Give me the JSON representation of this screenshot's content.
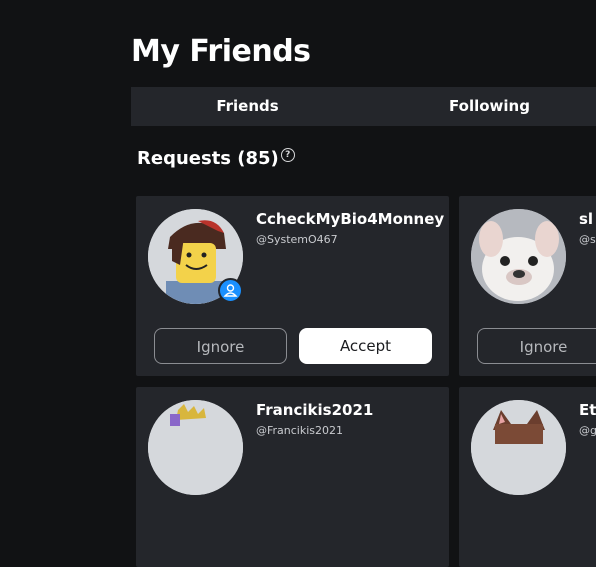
{
  "page": {
    "title": "My Friends"
  },
  "tabs": [
    {
      "label": "Friends"
    },
    {
      "label": "Following"
    }
  ],
  "requests": {
    "title": "Requests (85)",
    "help_glyph": "?",
    "cards": [
      {
        "name": "CcheckMyBio4Monney",
        "handle": "@SystemO467",
        "ignore_label": "Ignore",
        "accept_label": "Accept"
      },
      {
        "name": "sl",
        "handle": "@s",
        "ignore_label": "Ignore"
      },
      {
        "name": "Francikis2021",
        "handle": "@Francikis2021"
      },
      {
        "name": "Et",
        "handle": "@g"
      }
    ]
  },
  "colors": {
    "background": "#111214",
    "card": "#24262b",
    "accept_bg": "#ffffff",
    "badge": "#1a90ff"
  }
}
